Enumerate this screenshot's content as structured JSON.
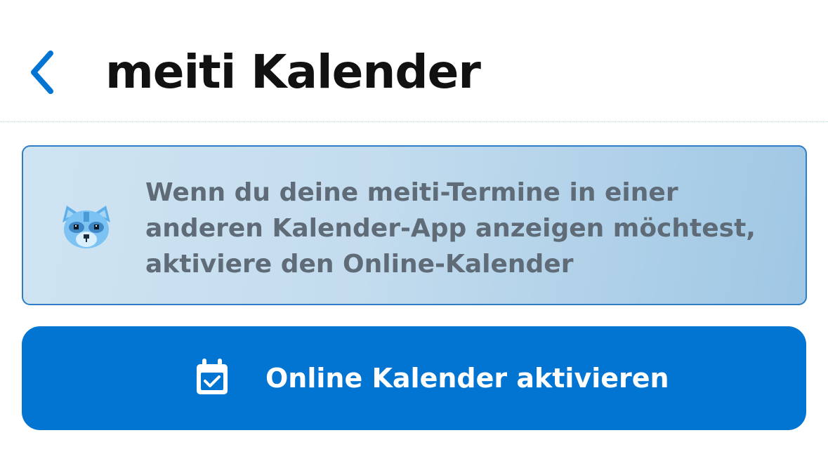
{
  "header": {
    "title": "meiti Kalender",
    "back_icon": "chevron-left-icon"
  },
  "info_card": {
    "mascot_icon": "raccoon-mascot-icon",
    "lines": [
      "Wenn du deine meiti-Termine in einer",
      "anderen Kalender-App anzeigen möchtest,",
      "aktiviere den Online-Kalender"
    ]
  },
  "cta": {
    "icon": "calendar-check-icon",
    "label": "Online Kalender aktivieren"
  },
  "colors": {
    "accent": "#0274d1",
    "card_border": "#2f7dc6",
    "card_text": "#5f6c78",
    "title_text": "#111111"
  }
}
